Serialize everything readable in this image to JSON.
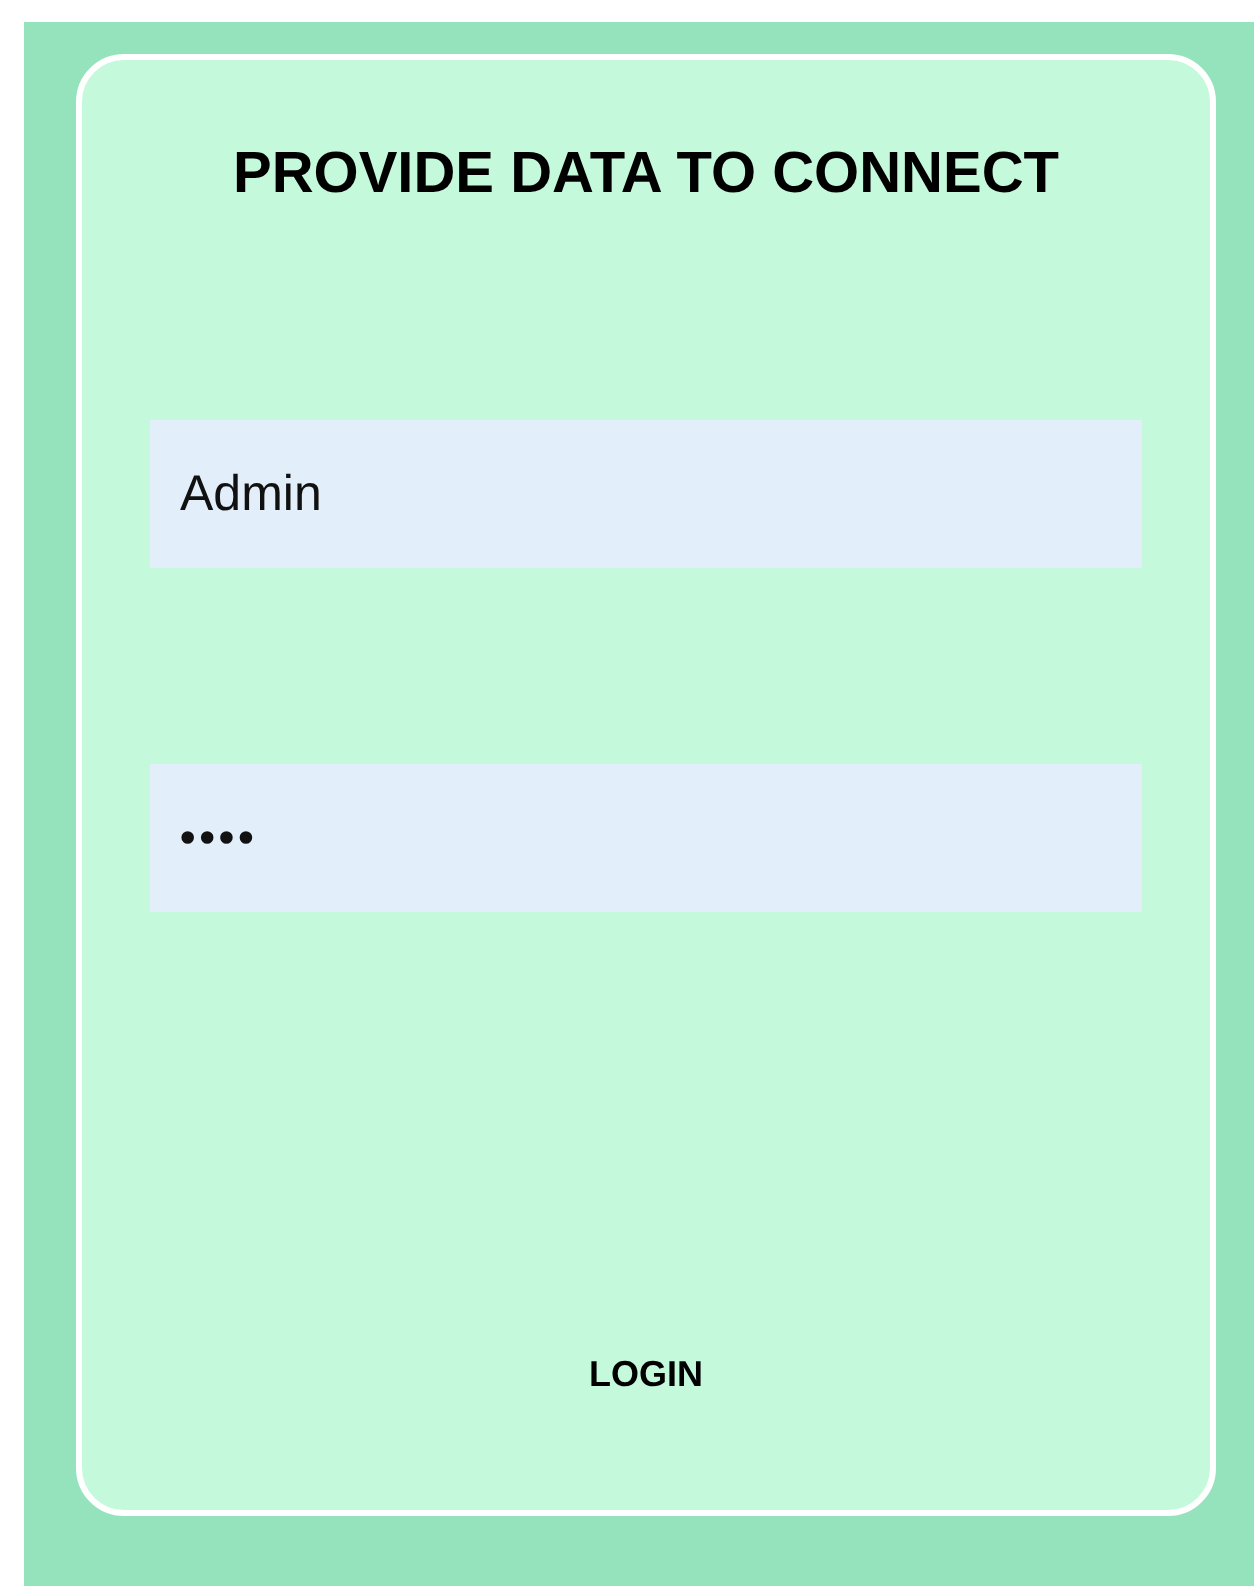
{
  "title": "PROVIDE DATA TO CONNECT",
  "fields": [
    {
      "kind": "text",
      "value": "Admin"
    },
    {
      "kind": "password",
      "value": "••••"
    }
  ],
  "button": "LOGIN"
}
